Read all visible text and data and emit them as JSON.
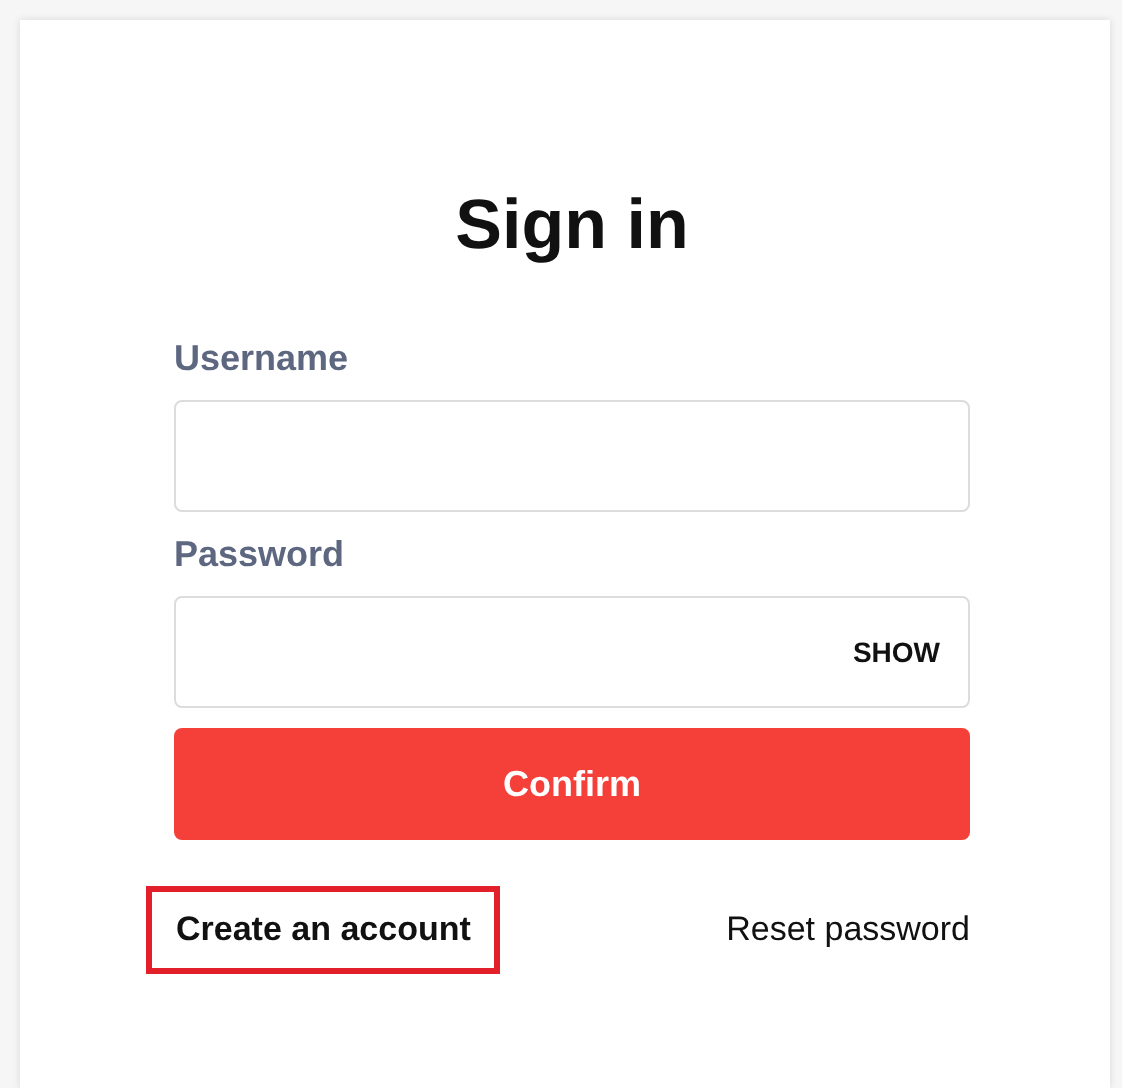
{
  "title": "Sign in",
  "fields": [
    {
      "label": "Username"
    },
    {
      "label": "Password",
      "toggle": "SHOW"
    }
  ],
  "confirm_button": "Confirm",
  "links": [
    {
      "label": "Create an account",
      "bold": true,
      "highlighted": true
    },
    {
      "label": "Reset password",
      "bold": false,
      "highlighted": false
    }
  ]
}
